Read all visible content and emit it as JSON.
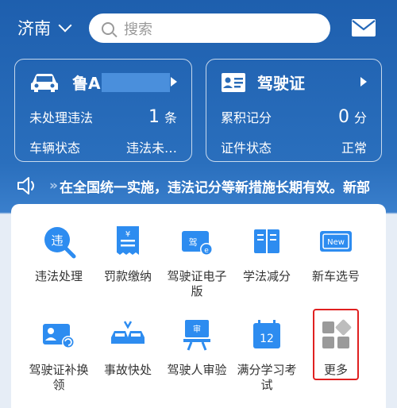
{
  "topbar": {
    "city": "济南",
    "search_placeholder": "搜索",
    "mail_icon": "mail-icon"
  },
  "vehicle_card": {
    "plate": "鲁A",
    "rows": [
      {
        "label": "未处理违法",
        "value": "1",
        "unit": "条"
      },
      {
        "label": "车辆状态",
        "value": "违法未…"
      }
    ]
  },
  "license_card": {
    "title": "驾驶证",
    "rows": [
      {
        "label": "累积记分",
        "value": "0",
        "unit": "分"
      },
      {
        "label": "证件状态",
        "value": "正常"
      }
    ]
  },
  "ticker": {
    "prefix": "»",
    "text": "在全国统一实施，违法记分等新措施长期有效。新部"
  },
  "services": [
    {
      "label": "违法处理",
      "icon": "violation-search-icon"
    },
    {
      "label": "罚款缴纳",
      "icon": "fine-receipt-icon"
    },
    {
      "label": "驾驶证电子版",
      "icon": "e-license-icon"
    },
    {
      "label": "学法减分",
      "icon": "book-icon"
    },
    {
      "label": "新车选号",
      "icon": "new-plate-icon"
    },
    {
      "label": "驾驶证补换领",
      "icon": "license-renew-icon"
    },
    {
      "label": "事故快处",
      "icon": "accident-icon"
    },
    {
      "label": "驾驶人审验",
      "icon": "review-board-icon"
    },
    {
      "label": "满分学习考试",
      "icon": "calendar-exam-icon"
    },
    {
      "label": "更多",
      "icon": "more-grid-icon"
    }
  ],
  "colors": {
    "brand_blue": "#2468b8",
    "highlight_red": "#e02020"
  }
}
